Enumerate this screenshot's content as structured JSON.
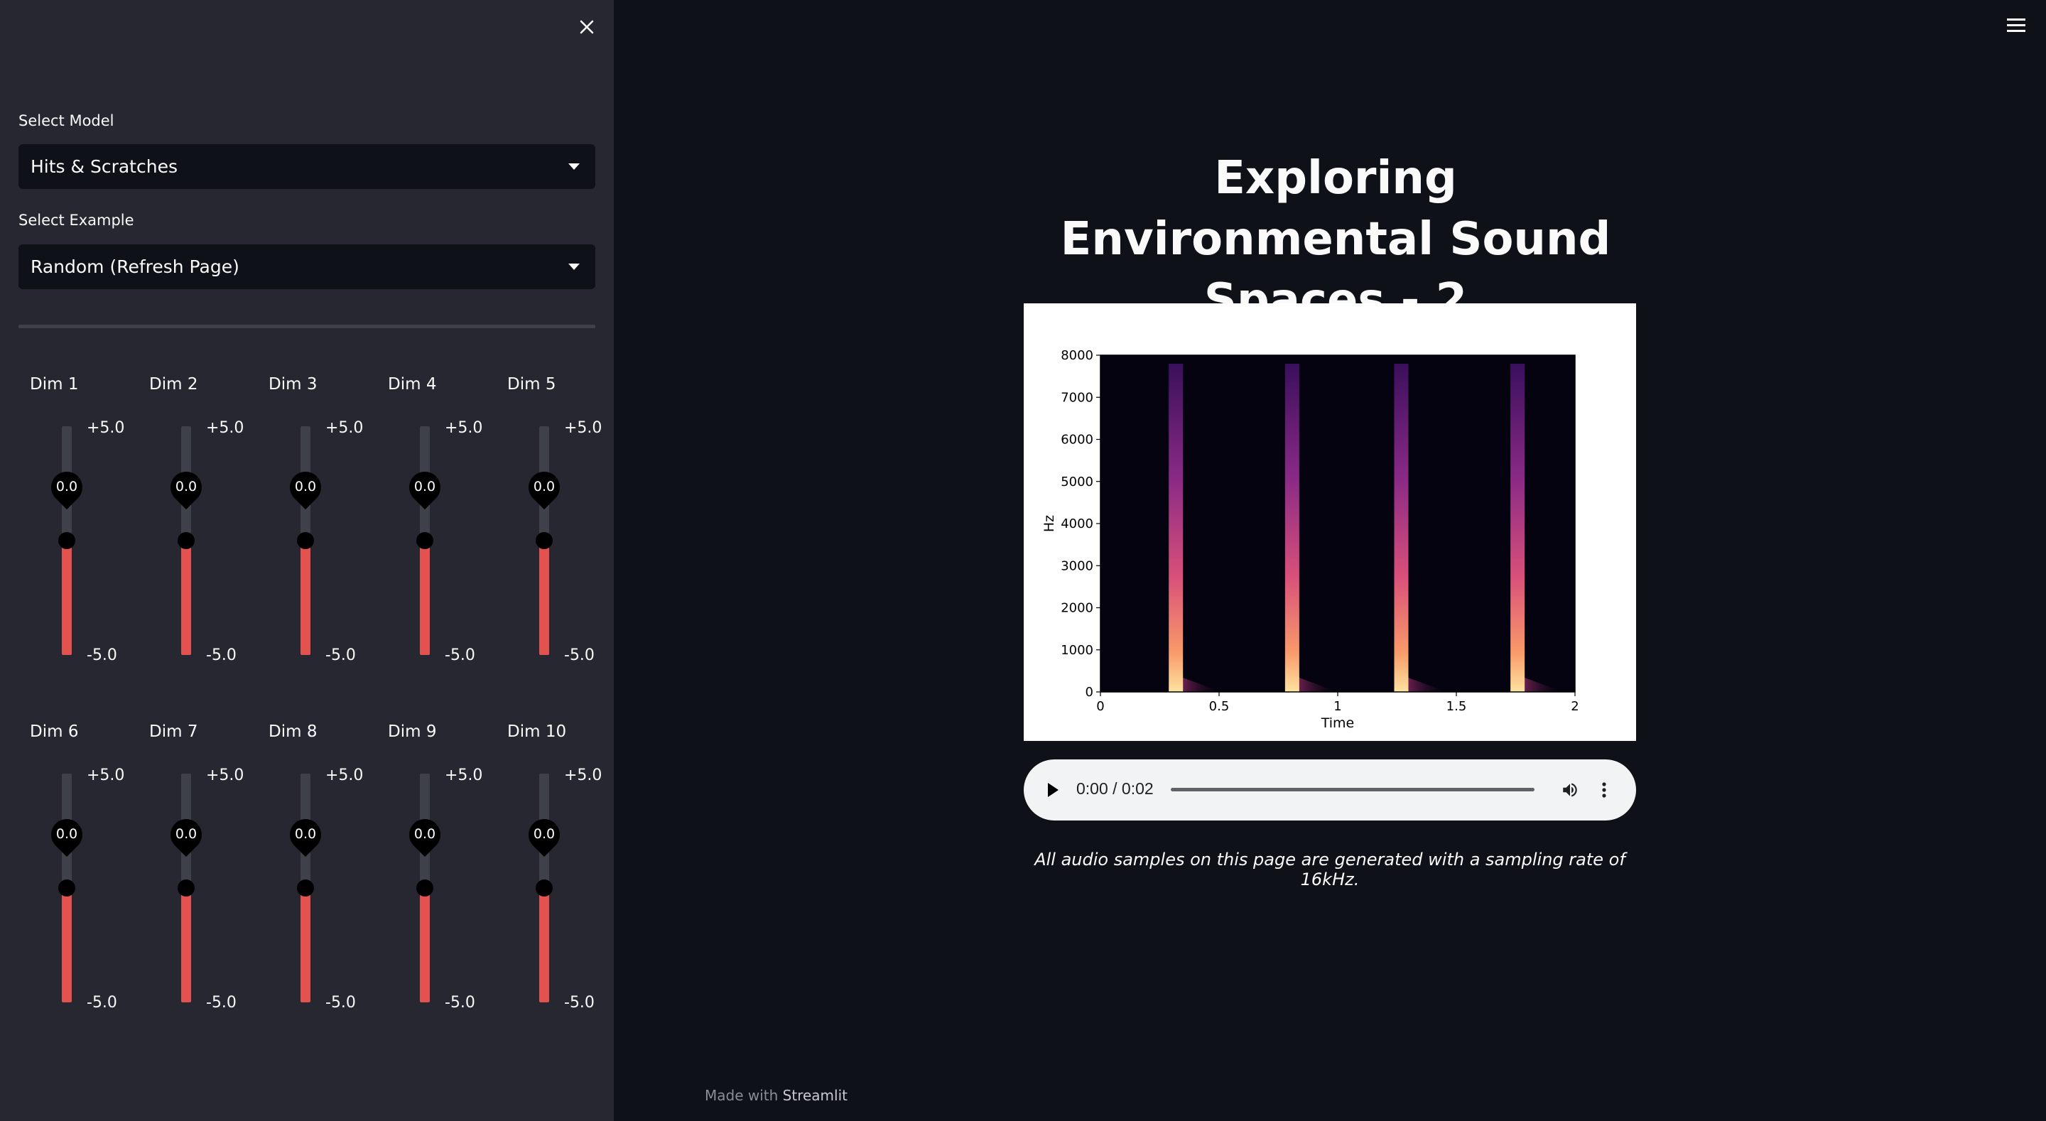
{
  "sidebar": {
    "model_label": "Select Model",
    "model_value": "Hits & Scratches",
    "example_label": "Select Example",
    "example_value": "Random (Refresh Page)",
    "sliders": [
      {
        "label": "Dim 1",
        "max": "+5.0",
        "min": "-5.0",
        "value": "0.0"
      },
      {
        "label": "Dim 2",
        "max": "+5.0",
        "min": "-5.0",
        "value": "0.0"
      },
      {
        "label": "Dim 3",
        "max": "+5.0",
        "min": "-5.0",
        "value": "0.0"
      },
      {
        "label": "Dim 4",
        "max": "+5.0",
        "min": "-5.0",
        "value": "0.0"
      },
      {
        "label": "Dim 5",
        "max": "+5.0",
        "min": "-5.0",
        "value": "0.0"
      },
      {
        "label": "Dim 6",
        "max": "+5.0",
        "min": "-5.0",
        "value": "0.0"
      },
      {
        "label": "Dim 7",
        "max": "+5.0",
        "min": "-5.0",
        "value": "0.0"
      },
      {
        "label": "Dim 8",
        "max": "+5.0",
        "min": "-5.0",
        "value": "0.0"
      },
      {
        "label": "Dim 9",
        "max": "+5.0",
        "min": "-5.0",
        "value": "0.0"
      },
      {
        "label": "Dim 10",
        "max": "+5.0",
        "min": "-5.0",
        "value": "0.0"
      }
    ]
  },
  "main": {
    "title": "Exploring Environmental Sound Spaces - 2",
    "audio_time": "0:00 / 0:02",
    "caption": "All audio samples on this page are generated with a sampling rate of 16kHz.",
    "footer_prefix": "Made with",
    "footer_brand": "Streamlit"
  },
  "chart_data": {
    "type": "heatmap",
    "title": "",
    "xlabel": "Time",
    "ylabel": "Hz",
    "xlim": [
      0,
      2
    ],
    "ylim": [
      0,
      8000
    ],
    "x_ticks": [
      "0",
      "0.5",
      "1",
      "1.5",
      "2"
    ],
    "y_ticks": [
      "0",
      "1000",
      "2000",
      "3000",
      "4000",
      "5000",
      "6000",
      "7000",
      "8000"
    ],
    "colormap": "magma",
    "onsets_seconds": [
      0.3,
      0.79,
      1.25,
      1.74
    ]
  },
  "colors": {
    "accent": "#e4524f",
    "sidebar_bg": "#262730",
    "main_bg": "#0e1117"
  }
}
